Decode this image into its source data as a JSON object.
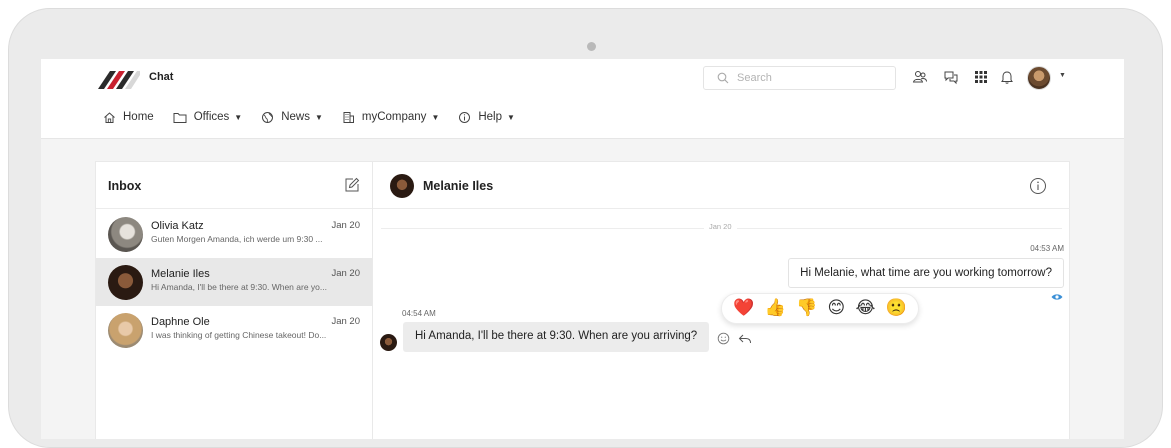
{
  "header": {
    "app_name": "Chat",
    "search_placeholder": "Search"
  },
  "nav": {
    "items": [
      {
        "label": "Home",
        "icon": "home-icon",
        "dropdown": false
      },
      {
        "label": "Offices",
        "icon": "folder-icon",
        "dropdown": true
      },
      {
        "label": "News",
        "icon": "globe-icon",
        "dropdown": true
      },
      {
        "label": "myCompany",
        "icon": "building-icon",
        "dropdown": true
      },
      {
        "label": "Help",
        "icon": "info-icon",
        "dropdown": true
      }
    ]
  },
  "inbox": {
    "title": "Inbox",
    "conversations": [
      {
        "name": "Olivia Katz",
        "date": "Jan 20",
        "preview": "Guten Morgen Amanda, ich werde um 9:30 ...",
        "active": false
      },
      {
        "name": "Melanie Iles",
        "date": "Jan 20",
        "preview": "Hi Amanda, I'll be there at 9:30. When are yo...",
        "active": true
      },
      {
        "name": "Daphne Ole",
        "date": "Jan 20",
        "preview": "I was thinking of getting Chinese takeout! Do...",
        "active": false
      }
    ]
  },
  "thread": {
    "contact_name": "Melanie Iles",
    "day_separator": "Jan 20",
    "outgoing": {
      "time": "04:53 AM",
      "text": "Hi Melanie, what time are you working tomorrow?"
    },
    "incoming": {
      "time": "04:54 AM",
      "text": "Hi Amanda, I'll be there at 9:30. When are you arriving?"
    },
    "reactions": [
      "❤️",
      "👍",
      "👎",
      "😊",
      "😂",
      "🙁"
    ]
  },
  "colors": {
    "seen_indicator": "#3a8fd6",
    "active_conversation_bg": "#e8e8e8",
    "logo_red": "#c8202f",
    "logo_dark": "#2b2b2b"
  }
}
